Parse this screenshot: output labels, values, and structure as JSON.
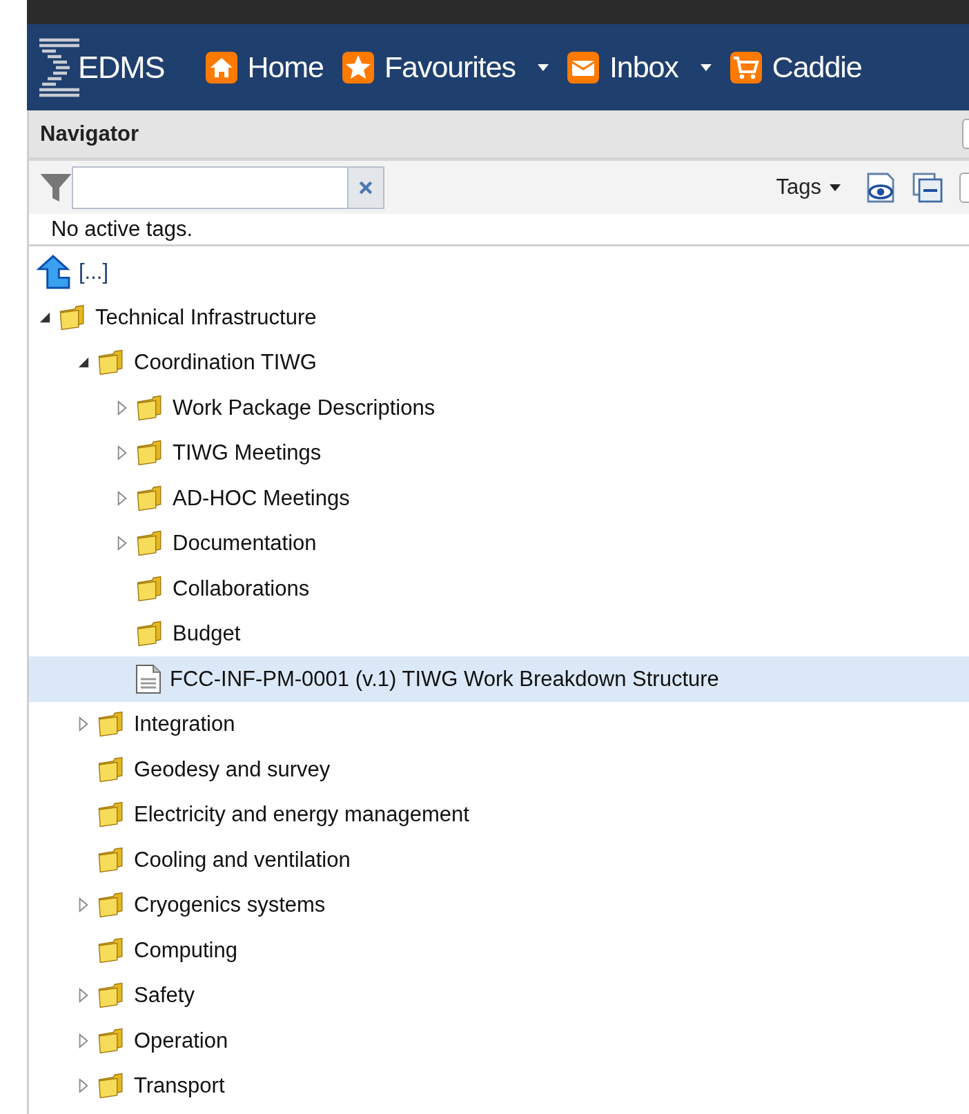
{
  "header": {
    "logo": "EDMS",
    "nav": [
      {
        "label": "Home",
        "kind": "home",
        "dropdown": false
      },
      {
        "label": "Favourites",
        "kind": "star",
        "dropdown": true
      },
      {
        "label": "Inbox",
        "kind": "mail",
        "dropdown": true
      },
      {
        "label": "Caddie",
        "kind": "cart",
        "dropdown": false
      }
    ]
  },
  "panel": {
    "title": "Navigator",
    "toolbar": {
      "tags_label": "Tags"
    },
    "tags_status": "No active tags.",
    "up_label": "[...]",
    "tree": [
      {
        "label": "Technical Infrastructure",
        "kind": "folder",
        "expanded": true,
        "selected": false,
        "children": [
          {
            "label": "Coordination TIWG",
            "kind": "folder",
            "expanded": true,
            "selected": false,
            "children": [
              {
                "label": "Work Package Descriptions",
                "kind": "folder",
                "expanded": false,
                "selected": false
              },
              {
                "label": "TIWG Meetings",
                "kind": "folder",
                "expanded": false,
                "selected": false
              },
              {
                "label": "AD-HOC Meetings",
                "kind": "folder",
                "expanded": false,
                "selected": false
              },
              {
                "label": "Documentation",
                "kind": "folder",
                "expanded": false,
                "selected": false
              },
              {
                "label": "Collaborations",
                "kind": "folder",
                "selected": false
              },
              {
                "label": "Budget",
                "kind": "folder",
                "selected": false
              },
              {
                "label": "FCC-INF-PM-0001 (v.1) TIWG Work Breakdown Structure",
                "kind": "document",
                "selected": true
              }
            ]
          },
          {
            "label": "Integration",
            "kind": "folder",
            "expanded": false,
            "selected": false
          },
          {
            "label": "Geodesy and survey",
            "kind": "folder",
            "selected": false
          },
          {
            "label": "Electricity and energy management",
            "kind": "folder",
            "selected": false
          },
          {
            "label": "Cooling and ventilation",
            "kind": "folder",
            "selected": false
          },
          {
            "label": "Cryogenics systems",
            "kind": "folder",
            "expanded": false,
            "selected": false
          },
          {
            "label": "Computing",
            "kind": "folder",
            "selected": false
          },
          {
            "label": "Safety",
            "kind": "folder",
            "expanded": false,
            "selected": false
          },
          {
            "label": "Operation",
            "kind": "folder",
            "expanded": false,
            "selected": false
          },
          {
            "label": "Transport",
            "kind": "folder",
            "expanded": false,
            "selected": false
          }
        ]
      }
    ]
  }
}
